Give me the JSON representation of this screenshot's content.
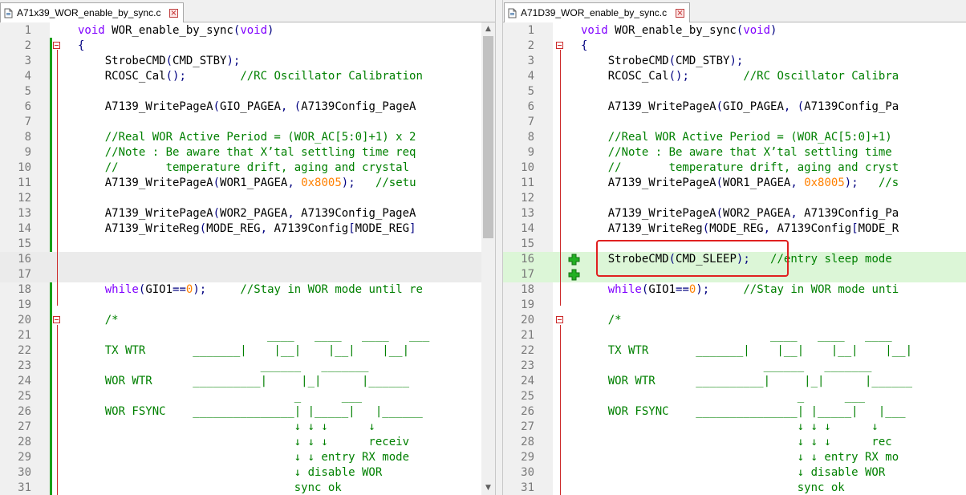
{
  "left": {
    "tab_title": "A71x39_WOR_enable_by_sync.c",
    "close_glyph": "×",
    "lines": [
      {
        "n": "1",
        "t": "void WOR_enable_by_sync(void)"
      },
      {
        "n": "2",
        "t": "{"
      },
      {
        "n": "3",
        "t": "    StrobeCMD(CMD_STBY);"
      },
      {
        "n": "4",
        "t": "    RCOSC_Cal();        //RC Oscillator Calibration"
      },
      {
        "n": "5",
        "t": ""
      },
      {
        "n": "6",
        "t": "    A7139_WritePageA(GIO_PAGEA, (A7139Config_PageA"
      },
      {
        "n": "7",
        "t": ""
      },
      {
        "n": "8",
        "t": "    //Real WOR Active Period = (WOR_AC[5:0]+1) x 2"
      },
      {
        "n": "9",
        "t": "    //Note : Be aware that X’tal settling time req"
      },
      {
        "n": "10",
        "t": "    //       temperature drift, aging and crystal"
      },
      {
        "n": "11",
        "t": "    A7139_WritePageA(WOR1_PAGEA, 0x8005);   //setu"
      },
      {
        "n": "12",
        "t": ""
      },
      {
        "n": "13",
        "t": "    A7139_WritePageA(WOR2_PAGEA, A7139Config_PageA"
      },
      {
        "n": "14",
        "t": "    A7139_WriteReg(MODE_REG, A7139Config[MODE_REG]"
      },
      {
        "n": "15",
        "t": ""
      },
      {
        "n": "16",
        "t": ""
      },
      {
        "n": "17",
        "t": ""
      },
      {
        "n": "18",
        "t": "    while(GIO1==0);     //Stay in WOR mode until re"
      },
      {
        "n": "19",
        "t": ""
      },
      {
        "n": "20",
        "t": "    /*"
      },
      {
        "n": "21",
        "t": "                            ____   ____   ____   ___"
      },
      {
        "n": "22",
        "t": "    TX WTR       _______|    |__|    |__|    |__|"
      },
      {
        "n": "23",
        "t": "                           ______   _______"
      },
      {
        "n": "24",
        "t": "    WOR WTR      __________|     |_|      |______"
      },
      {
        "n": "25",
        "t": "                                _      ___"
      },
      {
        "n": "26",
        "t": "    WOR FSYNC    _______________| |_____|   |______"
      },
      {
        "n": "27",
        "t": "                                ↓ ↓ ↓      ↓"
      },
      {
        "n": "28",
        "t": "                                ↓ ↓ ↓      receiv"
      },
      {
        "n": "29",
        "t": "                                ↓ ↓ entry RX mode"
      },
      {
        "n": "30",
        "t": "                                ↓ disable WOR"
      },
      {
        "n": "31",
        "t": "                                sync ok"
      }
    ]
  },
  "right": {
    "tab_title": "A71D39_WOR_enable_by_sync.c",
    "close_glyph": "×",
    "lines": [
      {
        "n": "1",
        "t": "void WOR_enable_by_sync(void)"
      },
      {
        "n": "2",
        "t": "{"
      },
      {
        "n": "3",
        "t": "    StrobeCMD(CMD_STBY);"
      },
      {
        "n": "4",
        "t": "    RCOSC_Cal();        //RC Oscillator Calibra"
      },
      {
        "n": "5",
        "t": ""
      },
      {
        "n": "6",
        "t": "    A7139_WritePageA(GIO_PAGEA, (A7139Config_Pa"
      },
      {
        "n": "7",
        "t": ""
      },
      {
        "n": "8",
        "t": "    //Real WOR Active Period = (WOR_AC[5:0]+1)"
      },
      {
        "n": "9",
        "t": "    //Note : Be aware that X’tal settling time"
      },
      {
        "n": "10",
        "t": "    //       temperature drift, aging and cryst"
      },
      {
        "n": "11",
        "t": "    A7139_WritePageA(WOR1_PAGEA, 0x8005);   //s"
      },
      {
        "n": "12",
        "t": ""
      },
      {
        "n": "13",
        "t": "    A7139_WritePageA(WOR2_PAGEA, A7139Config_Pa"
      },
      {
        "n": "14",
        "t": "    A7139_WriteReg(MODE_REG, A7139Config[MODE_R"
      },
      {
        "n": "15",
        "t": ""
      },
      {
        "n": "16",
        "t": "    StrobeCMD(CMD_SLEEP);   //entry sleep mode"
      },
      {
        "n": "17",
        "t": ""
      },
      {
        "n": "18",
        "t": "    while(GIO1==0);     //Stay in WOR mode unti"
      },
      {
        "n": "19",
        "t": ""
      },
      {
        "n": "20",
        "t": "    /*"
      },
      {
        "n": "21",
        "t": "                            ____   ____   ____"
      },
      {
        "n": "22",
        "t": "    TX WTR       _______|    |__|    |__|    |__|"
      },
      {
        "n": "23",
        "t": "                           ______   _______"
      },
      {
        "n": "24",
        "t": "    WOR WTR      __________|     |_|      |______"
      },
      {
        "n": "25",
        "t": "                                _      ___"
      },
      {
        "n": "26",
        "t": "    WOR FSYNC    _______________| |_____|   |___"
      },
      {
        "n": "27",
        "t": "                                ↓ ↓ ↓      ↓"
      },
      {
        "n": "28",
        "t": "                                ↓ ↓ ↓      rec"
      },
      {
        "n": "29",
        "t": "                                ↓ ↓ entry RX mo"
      },
      {
        "n": "30",
        "t": "                                ↓ disable WOR"
      },
      {
        "n": "31",
        "t": "                                sync ok"
      }
    ]
  },
  "colors": {
    "keyword": "#8000ff",
    "comment": "#008000",
    "number": "#ff8000",
    "added_line_bg": "#dcf6d7",
    "empty_line_bg": "#ebebeb",
    "change_bar": "#1aa01a",
    "fold_marker": "#cc2a2a",
    "highlight_box": "#e02020"
  },
  "icons": {
    "file": "file-icon",
    "close": "close-tab-icon",
    "added_marker": "plus-icon",
    "fold_marker": "fold-minus-icon"
  }
}
